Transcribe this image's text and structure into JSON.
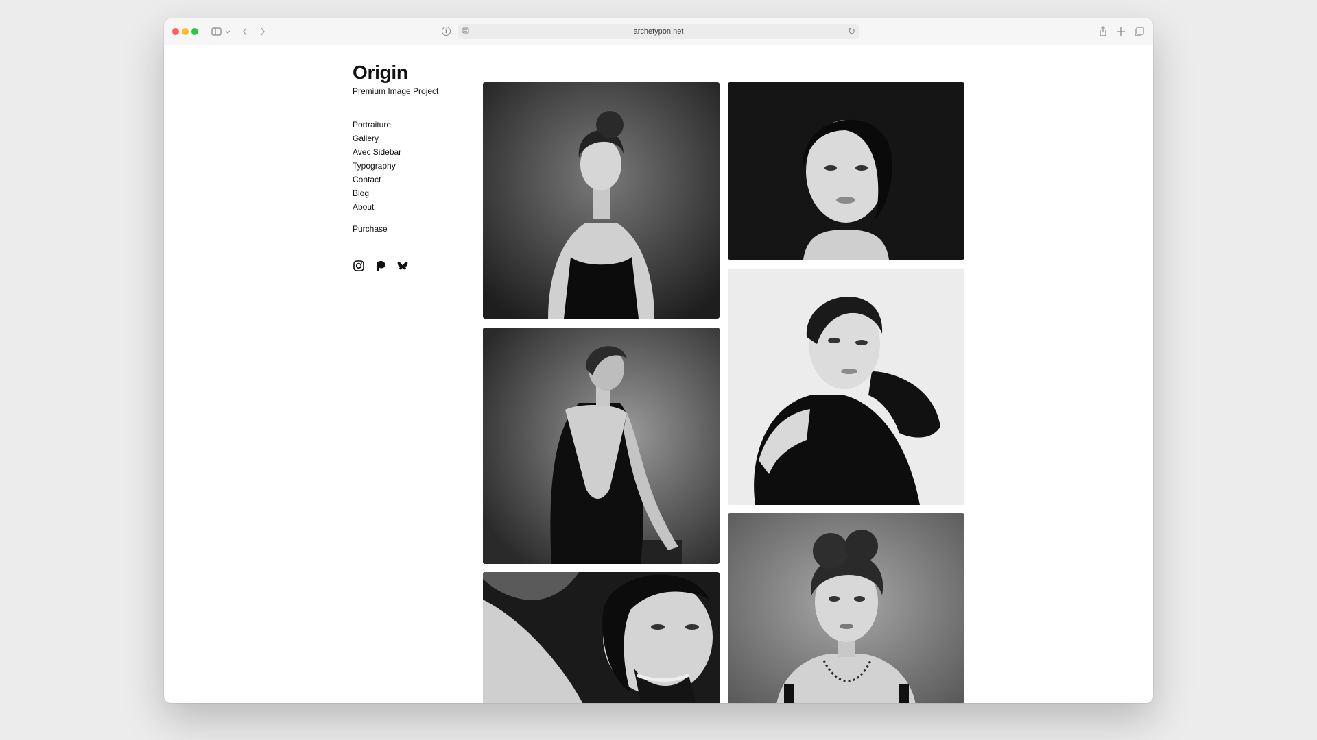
{
  "browser": {
    "url": "archetypon.net"
  },
  "site": {
    "title": "Origin",
    "tagline": "Premium Image Project"
  },
  "nav": {
    "items": [
      "Portraiture",
      "Gallery",
      "Avec Sidebar",
      "Typography",
      "Contact",
      "Blog",
      "About"
    ],
    "purchase": "Purchase"
  },
  "social": [
    "instagram-icon",
    "patreon-icon",
    "bluesky-icon"
  ],
  "gallery": {
    "photos": [
      "woman-in-black-dress-front",
      "woman-short-dark-hair-portrait",
      "woman-open-back-dress",
      "woman-black-sweater-pose",
      "woman-smiling-laughing",
      "woman-updo-necklace-portrait"
    ]
  },
  "colors": {
    "page_bg": "#ffffff",
    "text": "#111111",
    "desktop_bg": "#ececec"
  }
}
